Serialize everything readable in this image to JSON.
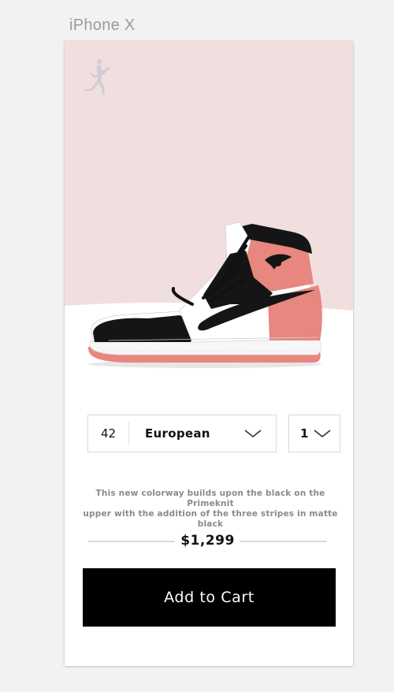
{
  "artboard": {
    "label": "iPhone X"
  },
  "colors": {
    "hero_background": "#f1dfe0",
    "accent_pink": "#e8877f",
    "button_background": "#000000",
    "button_text": "#ffffff"
  },
  "icons": {
    "brand": "jumpman-logo-icon",
    "dropdown": "chevron-down-icon"
  },
  "product": {
    "image": "sneaker-high-top-black-white-pink"
  },
  "selectors": {
    "size_value": "42",
    "size_system": "European",
    "quantity": "1"
  },
  "description": {
    "line1": "This new colorway builds upon the black on the Primeknit",
    "line2": "upper with the addition of the three stripes in matte black"
  },
  "price": "$1,299",
  "cta": {
    "label": "Add to Cart"
  }
}
